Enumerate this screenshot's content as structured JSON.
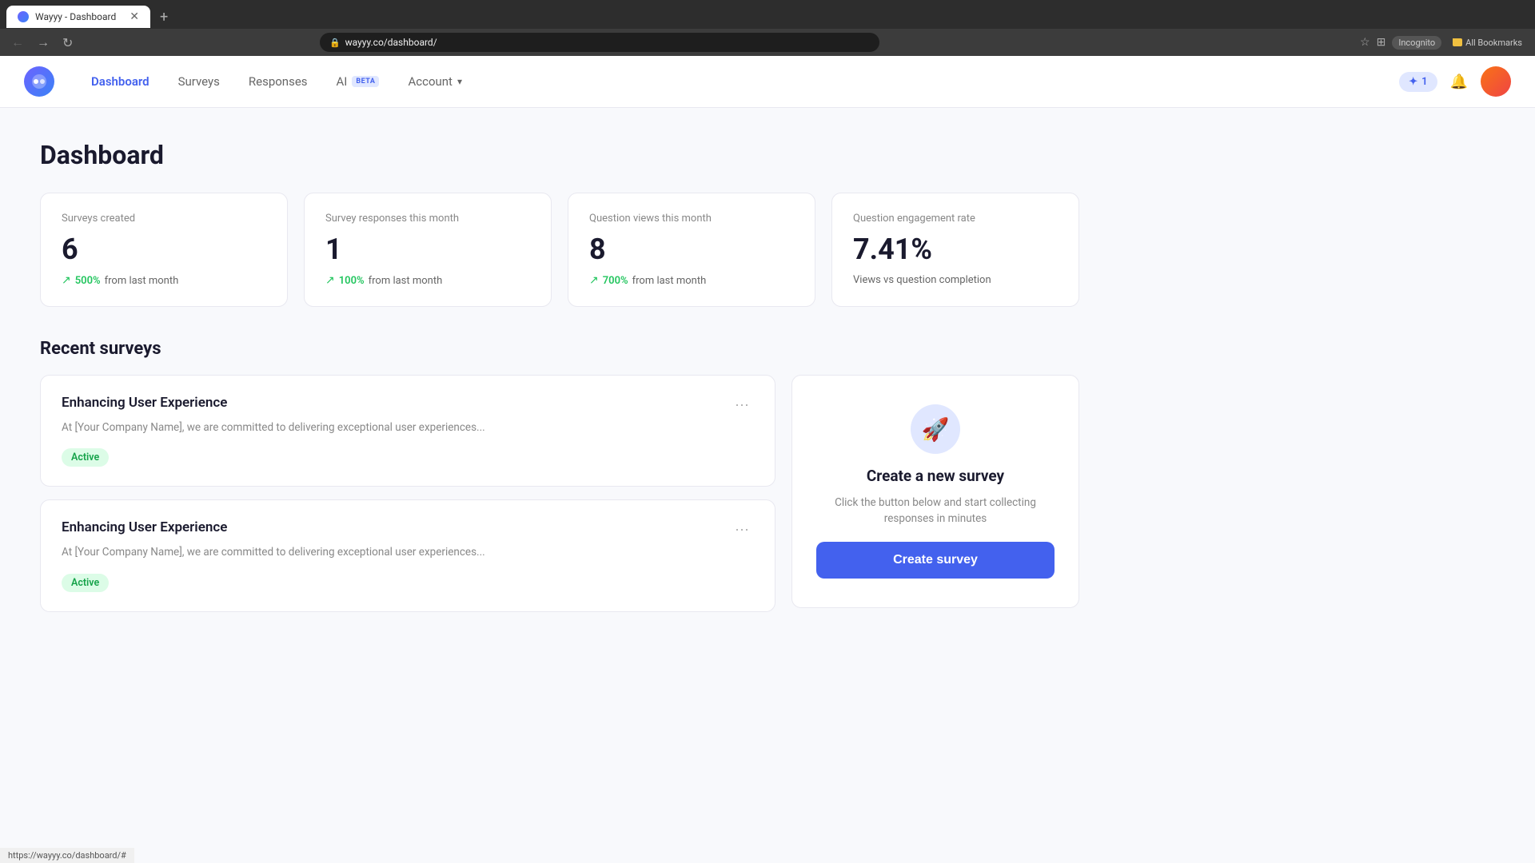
{
  "browser": {
    "tab_title": "Wayyy - Dashboard",
    "address": "wayyy.co/dashboard/",
    "incognito_label": "Incognito",
    "bookmarks_label": "All Bookmarks",
    "status_url": "https://wayyy.co/dashboard/#"
  },
  "navbar": {
    "logo_symbol": "●",
    "links": [
      {
        "id": "dashboard",
        "label": "Dashboard",
        "active": true
      },
      {
        "id": "surveys",
        "label": "Surveys",
        "active": false
      },
      {
        "id": "responses",
        "label": "Responses",
        "active": false
      },
      {
        "id": "ai",
        "label": "AI",
        "active": false,
        "badge": "BETA"
      },
      {
        "id": "account",
        "label": "Account",
        "active": false,
        "dropdown": true
      }
    ],
    "points": "1",
    "points_aria": "Points badge"
  },
  "page": {
    "title": "Dashboard"
  },
  "stats": [
    {
      "label": "Surveys created",
      "value": "6",
      "trend_percent": "500%",
      "trend_text": "from last month"
    },
    {
      "label": "Survey responses this month",
      "value": "1",
      "trend_percent": "100%",
      "trend_text": "from last month"
    },
    {
      "label": "Question views this month",
      "value": "8",
      "trend_percent": "700%",
      "trend_text": "from last month"
    },
    {
      "label": "Question engagement rate",
      "value": "7.41%",
      "trend_text": "Views vs question completion",
      "no_trend_icon": true
    }
  ],
  "recent_surveys": {
    "section_title": "Recent surveys",
    "surveys": [
      {
        "title": "Enhancing User Experience",
        "description": "At [Your Company Name], we are committed to delivering exceptional user experiences...",
        "status": "Active"
      },
      {
        "title": "Enhancing User Experience",
        "description": "At [Your Company Name], we are committed to delivering exceptional user experiences...",
        "status": "Active"
      }
    ],
    "menu_icon": "···"
  },
  "create_survey_card": {
    "icon": "🚀",
    "title": "Create a new survey",
    "description": "Click the button below and start collecting responses in minutes",
    "button_label": "Create survey"
  }
}
